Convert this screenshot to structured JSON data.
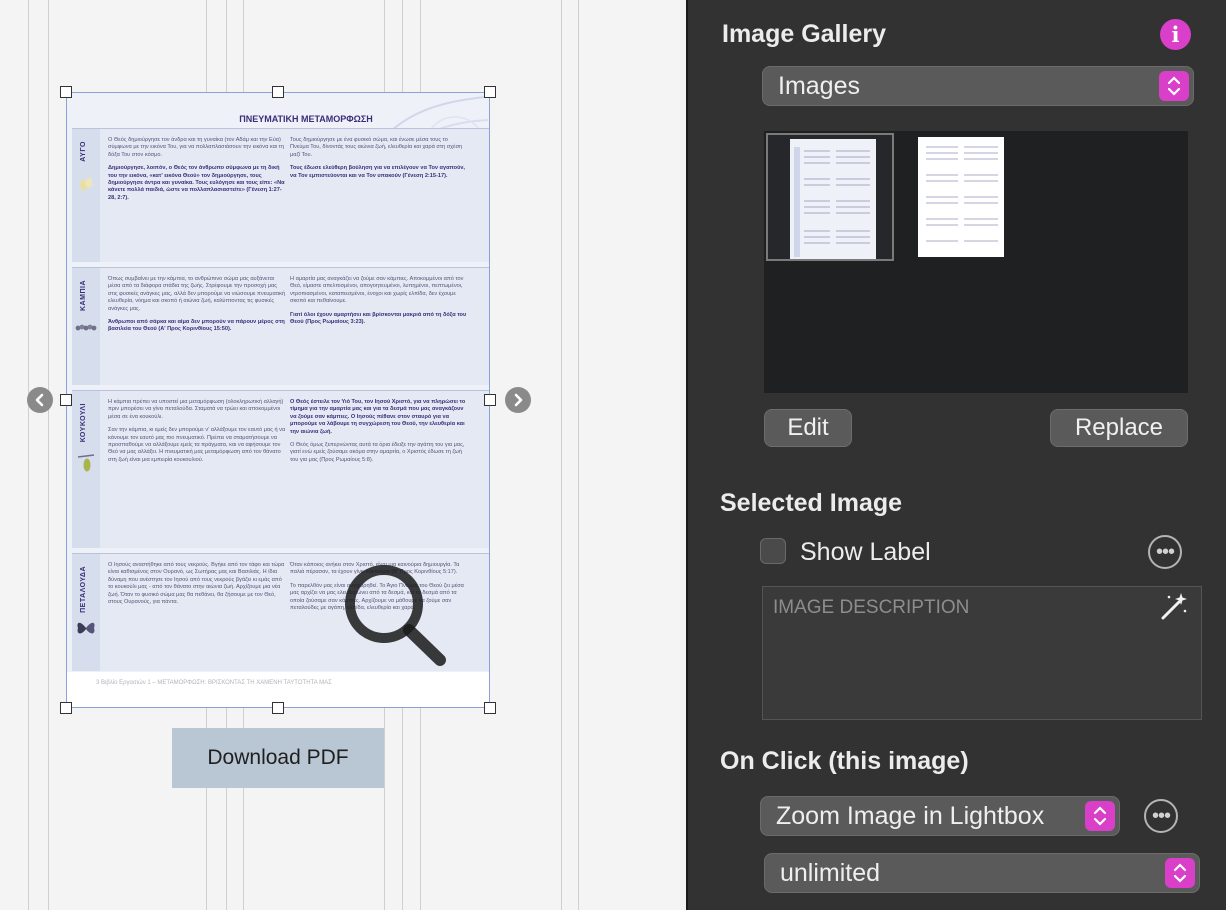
{
  "canvas": {
    "document": {
      "title": "ΠΝΕΥΜΑΤΙΚΗ ΜΕΤΑΜΟΡΦΩΣΗ",
      "sections": [
        {
          "label": "ΑΥΓΟ",
          "left": "Ο Θεός δημιούργησε τον άνδρα και τη γυναίκα (τον Αδάμ και την Εύα) σύμφωνα με την εικόνα Του, για να πολλαπλασιάσουν την εικόνα και τη δόξα Του στον κόσμο.",
          "left2": "Δημιούργησε, λοιπόν, ο Θεός τον άνθρωπο σύμφωνα με τη δική του την εικόνα, «κατ' εικόνα Θεού» τον δημιούργησε, τους δημιούργησε άντρα και γυναίκα. Τους ευλόγησε και τους είπε: «Να κάνετε πολλά παιδιά, ώστε να πολλαπλασιαστείτε» (Γένεση 1:27-28, 2:7).",
          "right": "Τους δημιούργησε με ένα φυσικό σώμα, και ένωσε μέσα τους το Πνεύμα Του, δίνοντάς τους αιώνια ζωή, ελευθερία και χαρά στη σχέση μαζί Του.",
          "right2": "Τους έδωσε ελεύθερη βούληση για να επιλέγουν να Τον αγαπούν, να Τον εμπιστεύονται και να Τον υπακούν (Γένεση 2:15-17)."
        },
        {
          "label": "ΚΑΜΠΙΑ",
          "left": "Όπως συμβαίνει με την κάμπια, το ανθρώπινο σώμα μας αυξάνεται μέσα από τα διάφορα στάδια της ζωής. Στρέφουμε την προσοχή μας στις φυσικές ανάγκες μας, αλλά δεν μπορούμε να νιώσουμε πνευματική ελευθερία, νόημα και σκοπό ή αιώνια ζωή, καλύπτοντας τις φυσικές ανάγκες μας.",
          "left2": "Άνθρωποι από σάρκα και αίμα δεν μπορούν να πάρουν μέρος στη βασιλεία του Θεού (Α' Προς Κορινθίους 15:50).",
          "right": "Η αμαρτία μας αναγκάζει να ζούμε σαν κάμπιες. Αποκομμένοι από τον Θεό, είμαστε απελπισμένοι, απογοητευμένοι, λυπημένοι, πεπτωμένοι, ντροπιασμένοι, καταπιεσμένοι, ένοχοι και χωρίς ελπίδα, δεν έχουμε σκοπό και πεθαίνουμε.",
          "right2": "Γιατί όλοι έχουν αμαρτήσει και βρίσκονται μακριά από τη δόξα του Θεού (Προς Ρωμαίους 3:23)."
        },
        {
          "label": "ΚΟΥΚΟΥΛΙ",
          "left": "Η κάμπια πρέπει να υποστεί μια μεταμόρφωση (ολοκληρωτική αλλαγή) πριν μπορέσει να γίνει πεταλούδα. Σταματά να τρώει και αποκομμένοι μέσα σε ένα κουκούλι.",
          "left2": "Σαν την κάμπια, κι εμείς δεν μπορούμε ν' αλλάξουμε τον εαυτό μας ή να κάνουμε τον εαυτό μας πιο πνευματικό. Πρέπει να σταματήσουμε να προσπαθούμε να αλλάξουμε εμείς τα πράγματα, και να αφήσουμε τον Θεό να μας αλλάξει. Η πνευματική μας μεταμόρφωση από τον θάνατο στη ζωή είναι μια εμπειρία κουκουλιού.",
          "right": "Ο Θεός έστειλε τον Υιό Του, τον Ιησού Χριστό, για να πληρώσει το τίμημα για την αμαρτία μας και για τα δεσμά που μας αναγκάζουν να ζούμε σαν κάμπιες. Ο Ιησούς πέθανε στον σταυρό για να μπορούμε να λάβουμε τη συγχώρεση του Θεού, την ελευθερία και την αιώνια ζωή.",
          "right2": "Ο Θεός όμως ξεπερνώντας αυτά τα όρια έδειξε την αγάπη του για μας, γιατί ενώ εμείς ζούσαμε ακόμα στην αμαρτία, ο Χριστός έδωσε τη ζωή του για μας (Προς Ρωμαίους 5:8)."
        },
        {
          "label": "ΠΕΤΑΛΟΥΔΑ",
          "left": "Ο Ιησούς αναστήθηκε από τους νεκρούς. Βγήκε από τον τάφο και τώρα είναι καθισμένος στον Ουρανό, ως Σωτήρας μας και Βασιλιάς. Η ίδια δύναμη που ανέστησε τον Ιησού από τους νεκρούς βγάζει κι εμάς από το κουκούλι μας - από τον θάνατο στην αιώνια ζωή. Αρχίζουμε μια νέα ζωή. Όταν το φυσικό σώμα μας θα πεθάνει, θα ζήσουμε με τον Θεό, στους Ουρανούς, για πάντα.",
          "left2": "",
          "right": "Όταν κάποιος ανήκει στον Χριστό, είναι μια καινούρια δημιουργία. Τα παλιά πέρασαν, τα έχουν γίνει καινούρια (Β' Προς Κορινθίους 5:17).",
          "right2": "Το παρελθόν μας είναι συγχωρηθεί. Το Άγιο Πνεύμα του Θεού ζει μέσα μας αρχίζει να μας ελευθερώνει από τα δεσμά, και τα δεσμά από τα οποία ζούσαμε σαν κάμπιες. Αρχίζουμε να μάθουμε να ζούμε σαν πεταλούδες με αγάπη, ελπίδα, ελευθερία και χαρά."
        }
      ],
      "footer": "3        Βιβλίο Εργασιών 1 – ΜΕΤΑΜΟΡΦΩΣΗ: ΒΡΙΣΚΟΝΤΑΣ ΤΗ ΧΑΜΕΝΗ ΤΑΥΤΟΤΗΤΑ ΜΑΣ"
    },
    "download_button": "Download PDF"
  },
  "inspector": {
    "title": "Image Gallery",
    "source_popup": "Images",
    "edit_button": "Edit",
    "replace_button": "Replace",
    "selected_image_heading": "Selected Image",
    "show_label": "Show Label",
    "show_label_checked": false,
    "description_placeholder": "IMAGE DESCRIPTION",
    "on_click_heading": "On Click (this image)",
    "on_click_popup": "Zoom Image in Lightbox",
    "limit_popup": "unlimited",
    "accent_color": "#d93fc8"
  }
}
